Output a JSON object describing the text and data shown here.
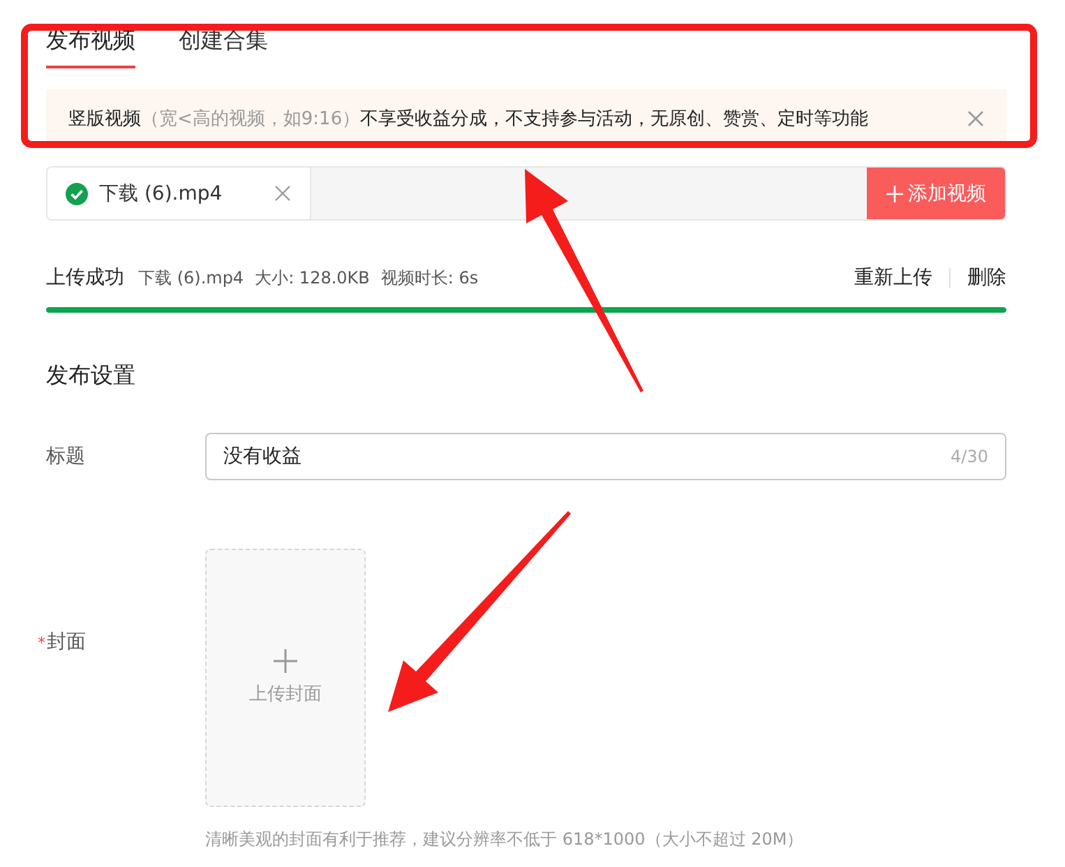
{
  "tabs": [
    {
      "label": "发布视频",
      "selected": true
    },
    {
      "label": "创建合集",
      "selected": false
    }
  ],
  "notice": {
    "lead": "竖版视频",
    "note": "（宽<高的视频，如9:16）",
    "text": "不享受收益分成，不支持参与活动，无原创、赞赏、定时等功能"
  },
  "file_row": {
    "file_name": "下载 (6).mp4",
    "uploaded": true,
    "add_button": "添加视频"
  },
  "upload_status": {
    "label": "上传成功",
    "file_name": "下载 (6).mp4",
    "size": "大小: 128.0KB",
    "duration": "视频时长: 6s",
    "actions": [
      "重新上传",
      "删除"
    ],
    "level": 1
  },
  "section_title": "发布设置",
  "title_field": {
    "label": "标题",
    "value": "没有收益",
    "counter": "4/30"
  },
  "cover": {
    "required_mark": "*",
    "label": "封面",
    "upload_label": "上传封面",
    "hint": "清晰美观的封面有利于推荐，建议分辨率不低于 618*1000（大小不超过 20M）"
  },
  "annotations": [
    {
      "kind": "frame"
    },
    {
      "kind": "arrow"
    },
    {
      "kind": "arrow"
    }
  ]
}
